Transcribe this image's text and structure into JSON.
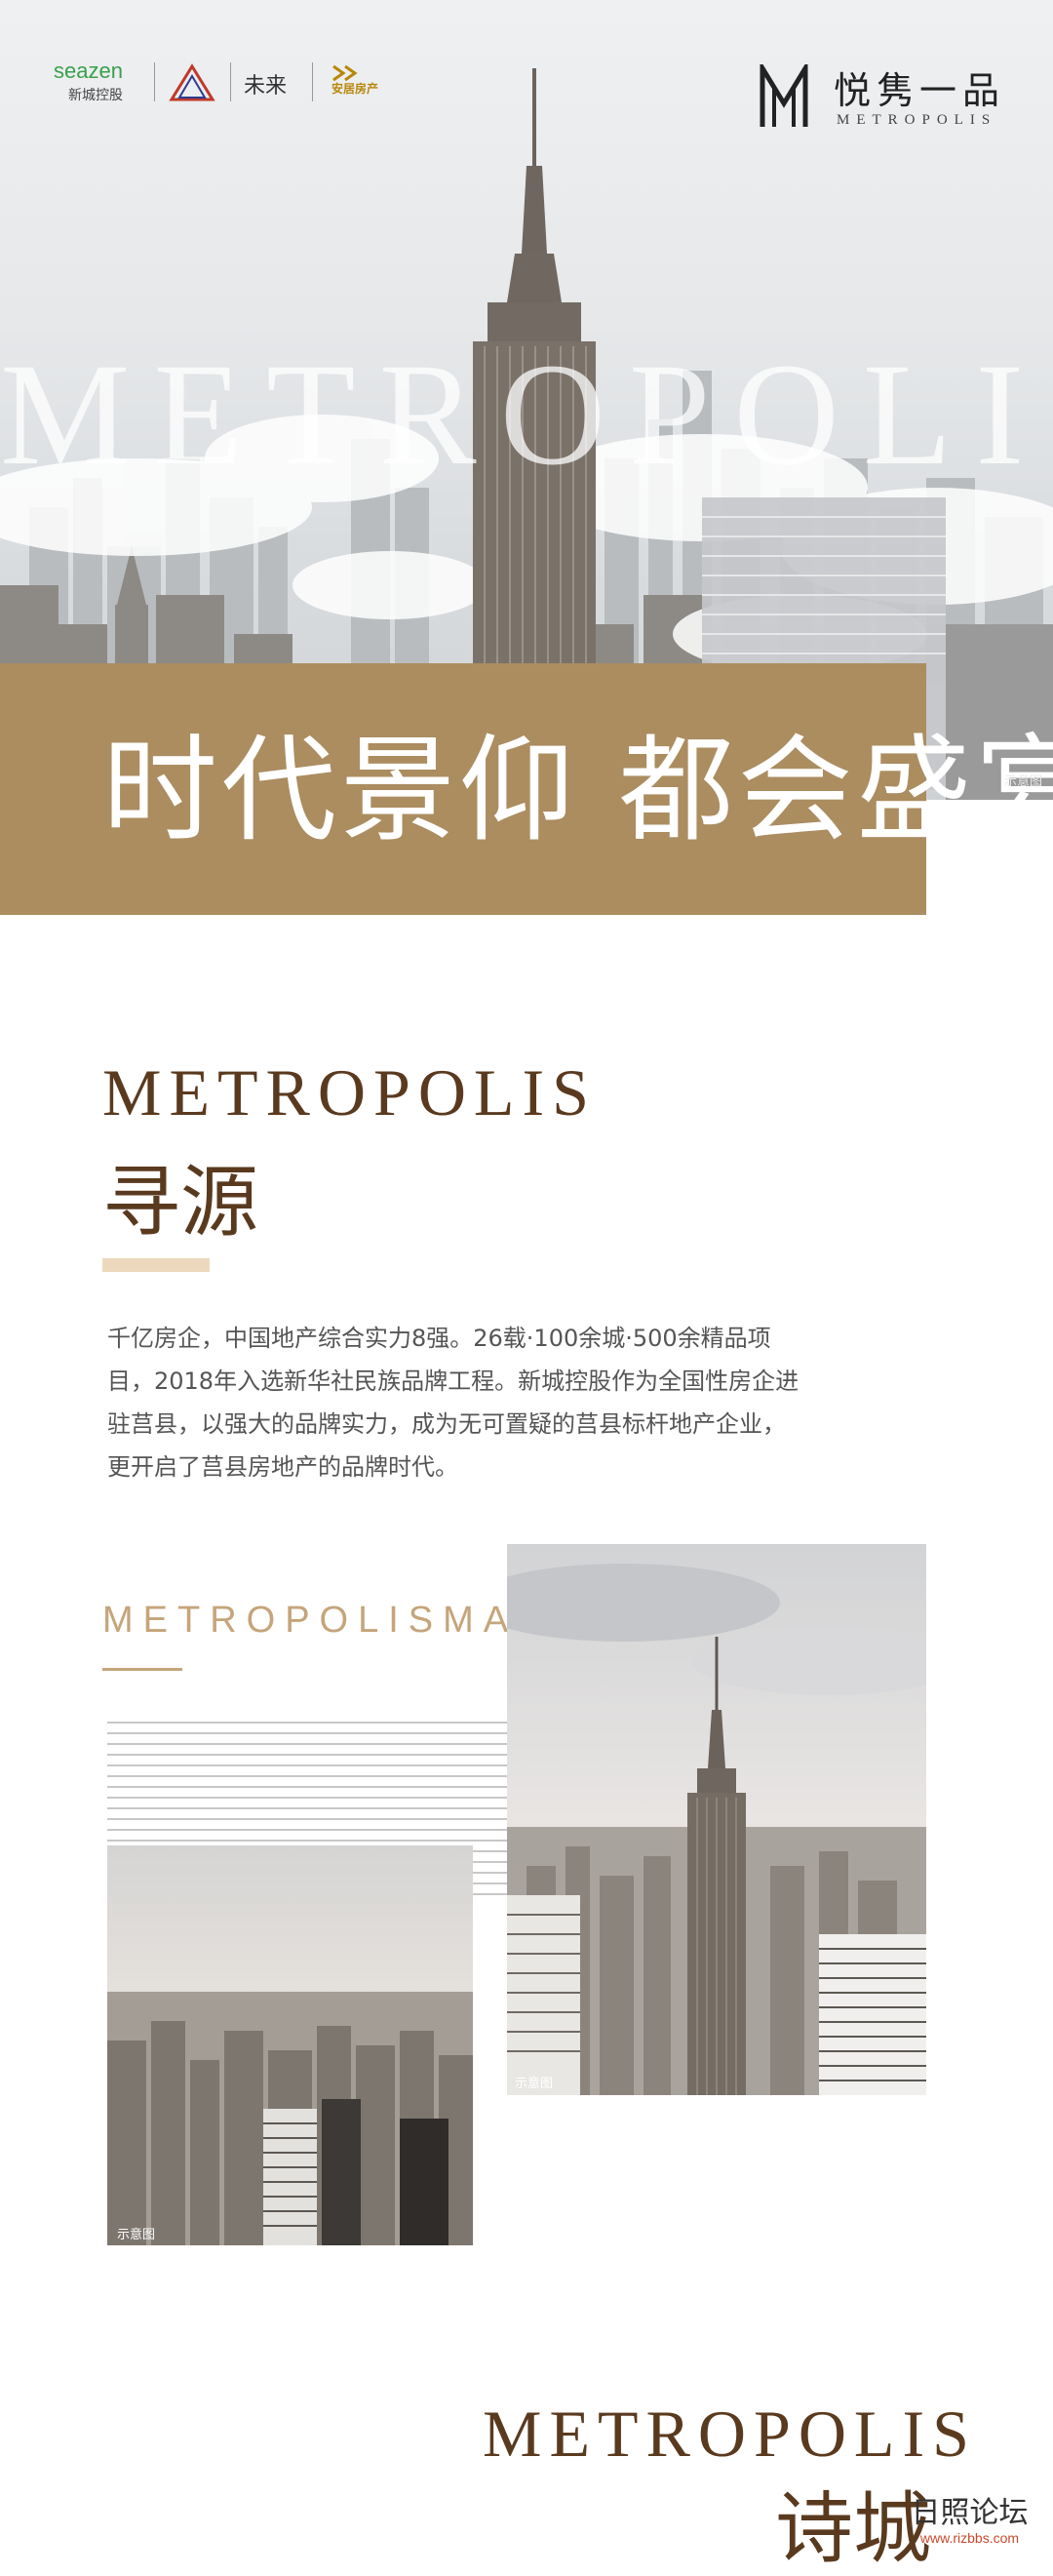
{
  "brands": {
    "seazen_en": "seazen",
    "seazen_cn": "新城控股",
    "future": "未来",
    "anju": "安居房产"
  },
  "project_logo": {
    "cn": "悦隽一品",
    "en": "METROPOLIS"
  },
  "hero": {
    "watermark": "METROPOLIS",
    "title": "时代景仰 都会盛宴",
    "illustration_note": "示意图"
  },
  "section1": {
    "eyebrow": "METROPOLIS",
    "heading": "寻源",
    "body": [
      "千亿房企，中国地产综合实力8强。26载·100余城·500余精品项",
      "目，2018年入选新华社民族品牌工程。新城控股作为全国性房企进",
      "驻莒县，以强大的品牌实力，成为无可置疑的莒县标杆地产企业，",
      "更开启了莒县房地产的品牌时代。"
    ]
  },
  "collage": {
    "label": "METROPOLISMANSION",
    "illustration_note_right": "示意图",
    "illustration_note_left": "示意图"
  },
  "section2": {
    "eyebrow": "METROPOLIS",
    "heading": "诗城"
  },
  "watermark": {
    "cn": "日照论坛",
    "url": "www.rizbbs.com"
  },
  "colors": {
    "accent_gold": "#ab8d60",
    "heading_brown": "#5a3a1e",
    "highlight": "#ecd9bd",
    "seazen_green": "#3aa04a"
  }
}
